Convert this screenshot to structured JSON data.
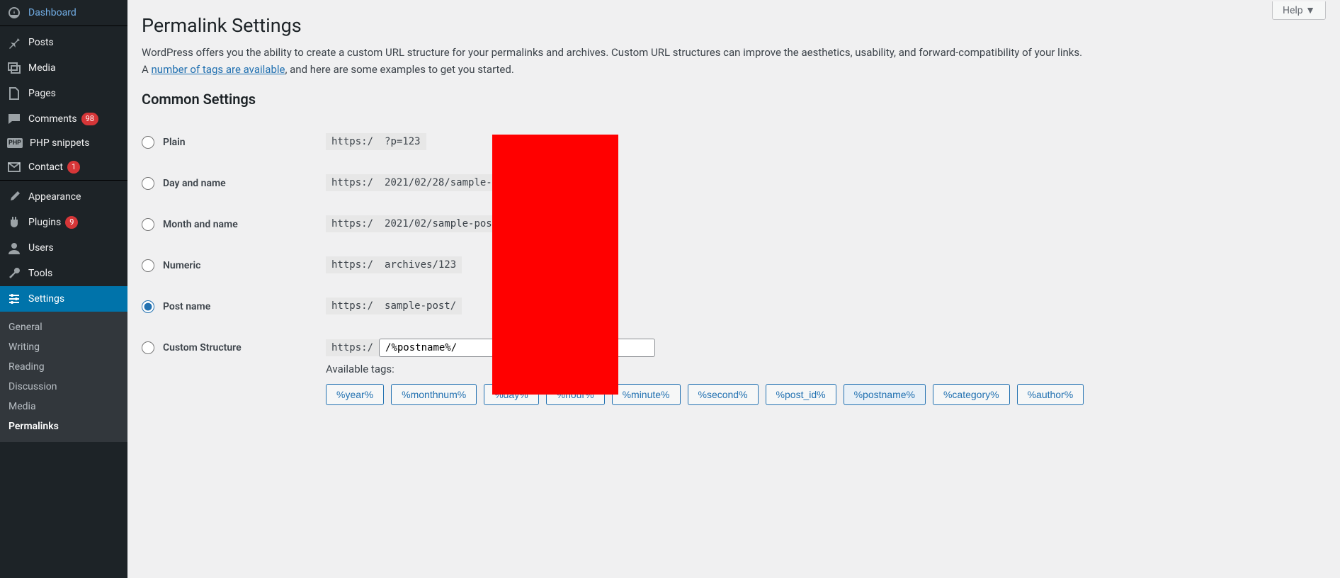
{
  "help_label": "Help ▼",
  "sidebar": {
    "dashboard": "Dashboard",
    "posts": "Posts",
    "media": "Media",
    "pages": "Pages",
    "comments": "Comments",
    "comments_badge": "98",
    "php": "PHP snippets",
    "contact": "Contact",
    "contact_badge": "1",
    "appearance": "Appearance",
    "plugins": "Plugins",
    "plugins_badge": "9",
    "users": "Users",
    "tools": "Tools",
    "settings": "Settings",
    "sub": {
      "general": "General",
      "writing": "Writing",
      "reading": "Reading",
      "discussion": "Discussion",
      "media": "Media",
      "permalinks": "Permalinks"
    }
  },
  "page": {
    "title": "Permalink Settings",
    "intro_a": "WordPress offers you the ability to create a custom URL structure for your permalinks and archives. Custom URL structures can improve the aesthetics, usability, and forward-compatibility of your links. A ",
    "intro_link": "number of tags are available",
    "intro_b": ", and here are some examples to get you started.",
    "section": "Common Settings"
  },
  "rows": {
    "plain": {
      "label": "Plain",
      "pre": "https:/",
      "post": "?p=123"
    },
    "day": {
      "label": "Day and name",
      "pre": "https:/",
      "post": "2021/02/28/sample-post/"
    },
    "month": {
      "label": "Month and name",
      "pre": "https:/",
      "post": "2021/02/sample-post/"
    },
    "numeric": {
      "label": "Numeric",
      "pre": "https:/",
      "post": "archives/123"
    },
    "postname": {
      "label": "Post name",
      "pre": "https:/",
      "post": "sample-post/"
    },
    "custom": {
      "label": "Custom Structure",
      "pre": "https:/",
      "value": "/%postname%/"
    }
  },
  "tags": {
    "label": "Available tags:",
    "items": [
      "%year%",
      "%monthnum%",
      "%day%",
      "%hour%",
      "%minute%",
      "%second%",
      "%post_id%",
      "%postname%",
      "%category%",
      "%author%"
    ],
    "active": "%postname%"
  }
}
